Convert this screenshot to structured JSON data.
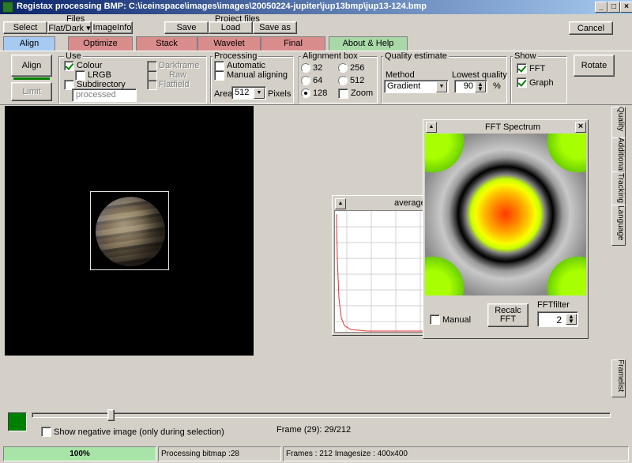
{
  "window": {
    "title": "Registax processing BMP: C:\\iceinspace\\images\\images\\20050224-jupiter\\jup13bmp\\jup13-124.bmp",
    "min_label": "_",
    "max_label": "□",
    "close_label": "×"
  },
  "toolbar": {
    "files_label": "Files",
    "project_files_label": "Project files",
    "select_label": "Select",
    "flatdark_label": "Flat/Dark ▾",
    "imageinfo_label": "ImageInfo",
    "save_label": "Save",
    "load_label": "Load",
    "saveas_label": "Save as",
    "cancel_label": "Cancel"
  },
  "tabs": [
    {
      "label": "Align",
      "color": "#a6caf0"
    },
    {
      "label": "Optimize",
      "color": "#d98c8c"
    },
    {
      "label": "Stack",
      "color": "#d98c8c"
    },
    {
      "label": "Wavelet",
      "color": "#d98c8c"
    },
    {
      "label": "Final",
      "color": "#d98c8c"
    },
    {
      "label": "About & Help",
      "color": "#a8d8a8"
    }
  ],
  "align_panel": {
    "align_label": "Align",
    "limit_label": "Limit",
    "use": {
      "label": "Use",
      "colour": "Colour",
      "lrgb": "LRGB",
      "subdirectory": "Subdirectory",
      "subdir_value": "processed",
      "darkframe": "Darkframe",
      "raw": "Raw",
      "flatfield": "Flatfield"
    },
    "processing": {
      "label": "Processing",
      "automatic": "Automatic",
      "manual": "Manual aligning",
      "area_label": "Area",
      "area_value": "512",
      "pixels_label": "Pixels"
    },
    "alignment_box": {
      "label": "Alignment box",
      "o32": "32",
      "o64": "64",
      "o128": "128",
      "o256": "256",
      "o512": "512",
      "zoom": "Zoom"
    },
    "quality": {
      "label": "Quality estimate",
      "method_label": "Method",
      "method_value": "Gradient",
      "lowest_label": "Lowest quality",
      "lowest_value": "90",
      "percent": "%"
    },
    "show": {
      "label": "Show",
      "fft": "FFT",
      "graph": "Graph"
    },
    "rotate_label": "Rotate"
  },
  "graph": {
    "title": "average q"
  },
  "fft": {
    "title": "FFT Spectrum",
    "close": "×",
    "manual_label": "Manual",
    "recalc_line1": "Recalc",
    "recalc_line2": "FFT",
    "filter_label": "FFTfilter",
    "filter_value": "2"
  },
  "side_tabs": {
    "quality": "Quality",
    "additional": "Additional",
    "tracking": "Tracking",
    "language": "Language",
    "framelist": "Framelist"
  },
  "bottom": {
    "show_negative": "Show negative image (only during selection)",
    "frame_text": "Frame (29): 29/212",
    "slider_fraction": 0.136
  },
  "status": {
    "progress_text": "100%",
    "progress_fraction": 1.0,
    "processing_text": "Processing bitmap :28",
    "frames_text": "Frames : 212 Imagesize : 400x400"
  }
}
